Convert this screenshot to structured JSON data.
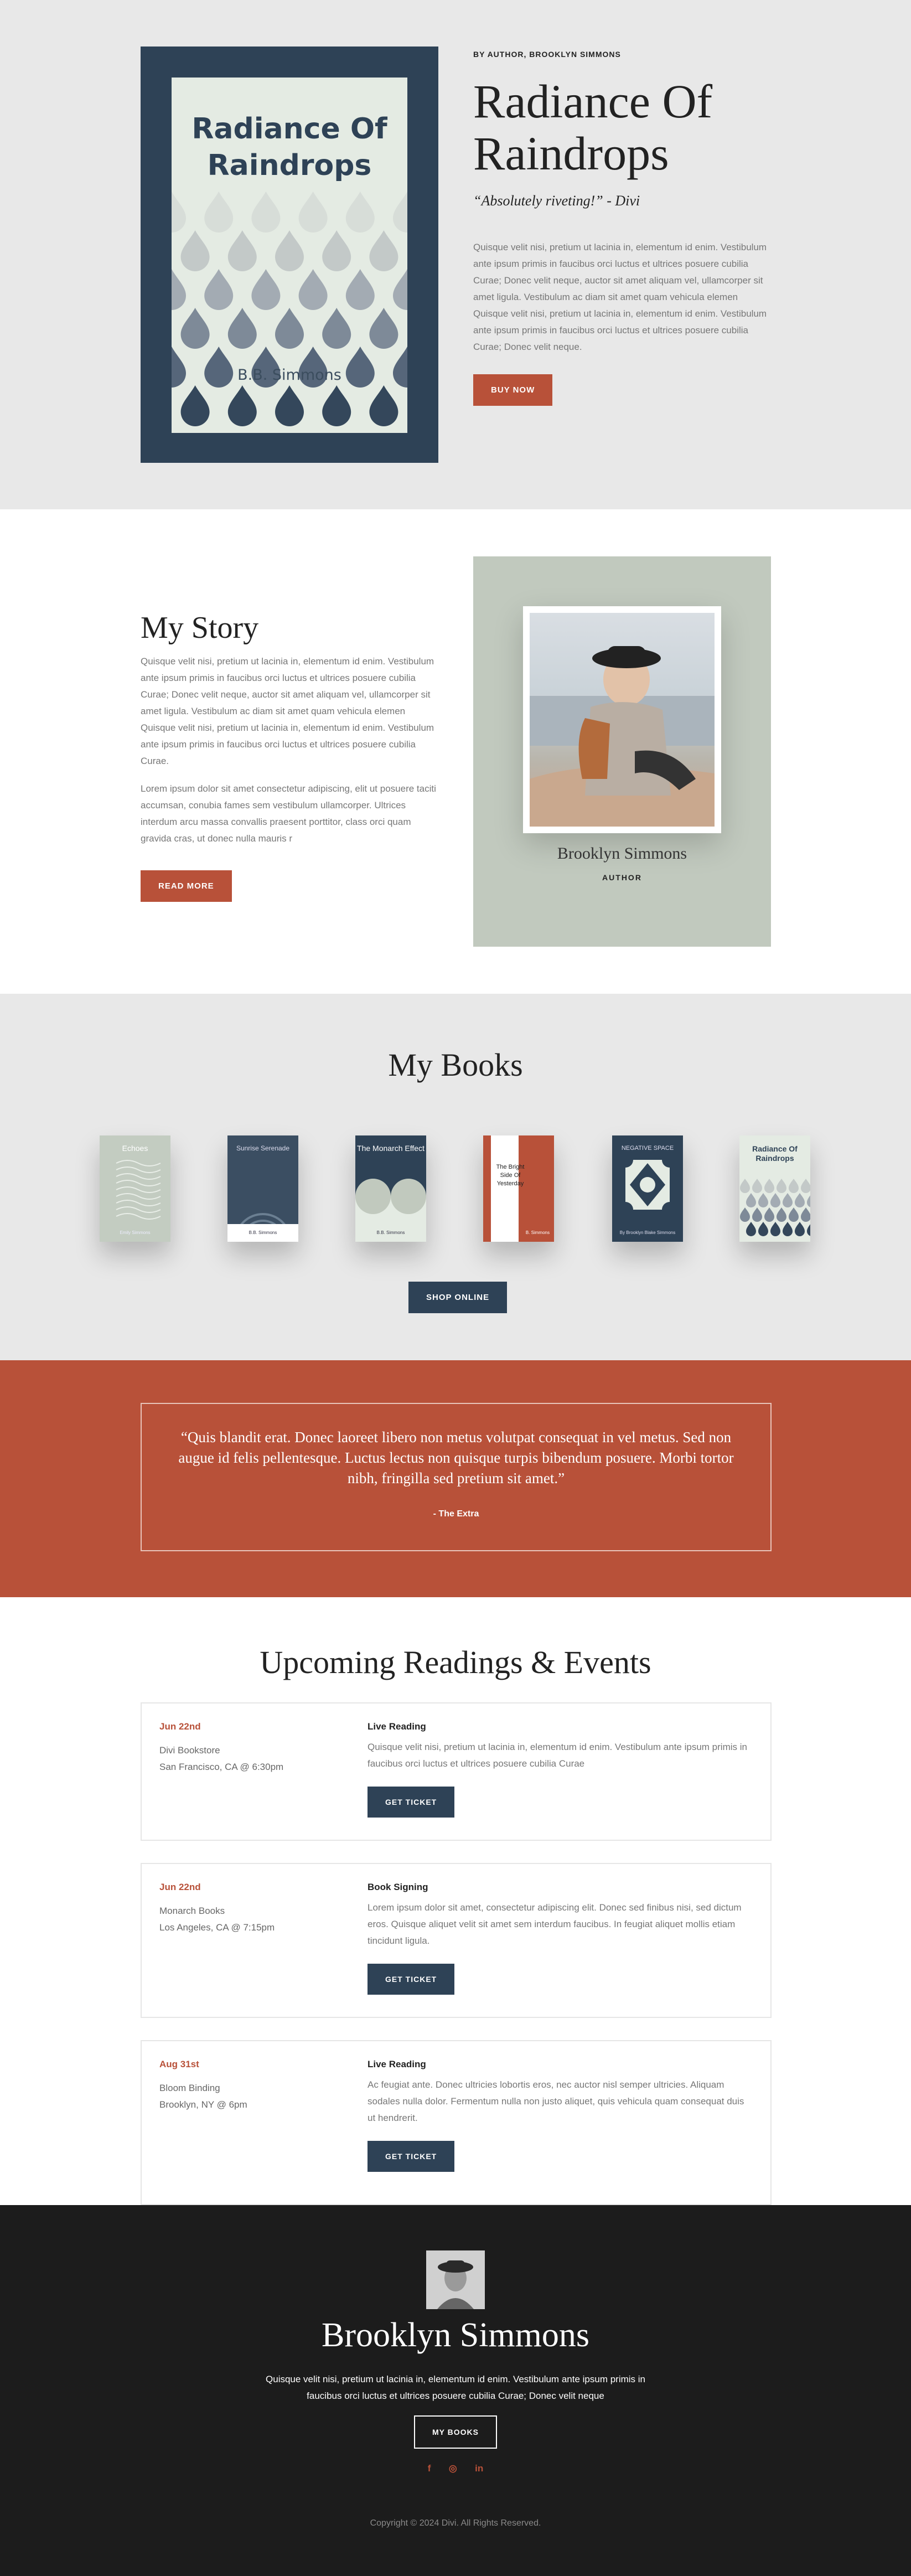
{
  "hero": {
    "cover_title": "Radiance Of Raindrops",
    "cover_author": "B.B. Simmons",
    "byline": "BY AUTHOR, BROOKLYN SIMMONS",
    "title": "Radiance Of Raindrops",
    "quote": "“Absolutely riveting!” - Divi",
    "text": "Quisque velit nisi, pretium ut lacinia in, elementum id enim. Vestibulum ante ipsum primis in faucibus orci luctus et ultrices posuere cubilia Curae; Donec velit neque, auctor sit amet aliquam vel, ullamcorper sit amet ligula. Vestibulum ac diam sit amet quam vehicula elemen Quisque velit nisi, pretium ut lacinia in, elementum id enim. Vestibulum ante ipsum primis in faucibus orci luctus et ultrices posuere cubilia Curae; Donec velit neque.",
    "button": "BUY NOW"
  },
  "story": {
    "title": "My Story",
    "p1": "Quisque velit nisi, pretium ut lacinia in, elementum id enim. Vestibulum ante ipsum primis in faucibus orci luctus et ultrices posuere cubilia Curae; Donec velit neque, auctor sit amet aliquam vel, ullamcorper sit amet ligula. Vestibulum ac diam sit amet quam vehicula elemen Quisque velit nisi, pretium ut lacinia in, elementum id enim. Vestibulum ante ipsum primis in faucibus orci luctus et ultrices posuere cubilia Curae.",
    "p2": "Lorem ipsum dolor sit amet consectetur adipiscing, elit ut posuere taciti accumsan, conubia fames sem vestibulum ullamcorper. Ultrices interdum arcu massa convallis praesent porttitor, class orci quam gravida cras, ut donec nulla mauris r",
    "button": "READ MORE",
    "name": "Brooklyn Simmons",
    "role": "AUTHOR"
  },
  "books": {
    "title": "My Books",
    "items": [
      {
        "title": "Echoes",
        "author": "Emily Simmons"
      },
      {
        "title": "Sunrise Serenade",
        "author": "B.B. Simmons"
      },
      {
        "title": "The Monarch Effect",
        "author": "B.B. Simmons"
      },
      {
        "title": "The Bright Side Of Yesterday",
        "author": "B. Simmons"
      },
      {
        "title": "NEGATIVE SPACE",
        "author": "By Brooklyn Blake Simmons"
      },
      {
        "title": "Radiance Of Raindrops",
        "author": ""
      }
    ],
    "button": "SHOP ONLINE"
  },
  "quote": {
    "text": "“Quis blandit erat. Donec laoreet libero non metus volutpat consequat in vel metus. Sed non augue id felis pellentesque. Luctus lectus non quisque turpis bibendum posuere. Morbi tortor nibh, fringilla sed pretium sit amet.”",
    "by": "- The Extra"
  },
  "events": {
    "title": "Upcoming Readings & Events",
    "items": [
      {
        "date": "Jun 22nd",
        "venue": "Divi Bookstore",
        "place": "San Francisco, CA @ 6:30pm",
        "type": "Live Reading",
        "desc": "Quisque velit nisi, pretium ut lacinia in, elementum id enim. Vestibulum ante ipsum primis in faucibus orci luctus et ultrices posuere cubilia Curae",
        "button": "GET TICKET"
      },
      {
        "date": "Jun 22nd",
        "venue": "Monarch Books",
        "place": "Los Angeles, CA @ 7:15pm",
        "type": "Book Signing",
        "desc": "Lorem ipsum dolor sit amet, consectetur adipiscing elit. Donec sed finibus nisi, sed dictum eros. Quisque aliquet velit sit amet sem interdum faucibus. In feugiat aliquet mollis etiam tincidunt ligula.",
        "button": "GET TICKET"
      },
      {
        "date": "Aug 31st",
        "venue": "Bloom Binding",
        "place": "Brooklyn, NY @ 6pm",
        "type": "Live Reading",
        "desc": "Ac feugiat ante. Donec ultricies lobortis eros, nec auctor nisl semper ultricies. Aliquam sodales nulla dolor. Fermentum nulla non justo aliquet, quis vehicula quam consequat duis ut hendrerit.",
        "button": "GET TICKET"
      }
    ]
  },
  "footer": {
    "name": "Brooklyn Simmons",
    "text": "Quisque velit nisi, pretium ut lacinia in, elementum id enim. Vestibulum ante ipsum primis in faucibus orci luctus et ultrices posuere cubilia Curae; Donec velit neque",
    "button": "MY BOOKS",
    "socials": [
      "f",
      "◎",
      "in"
    ],
    "social_icons": [
      "facebook-icon",
      "instagram-icon",
      "linkedin-icon"
    ],
    "copyright": "Copyright © 2024 Divi. All Rights Reserved."
  },
  "colors": {
    "accent": "#b85139",
    "navy": "#2e4256",
    "sage": "#c1c9be",
    "light": "#e8e8e8",
    "footer": "#1c1c1c"
  }
}
